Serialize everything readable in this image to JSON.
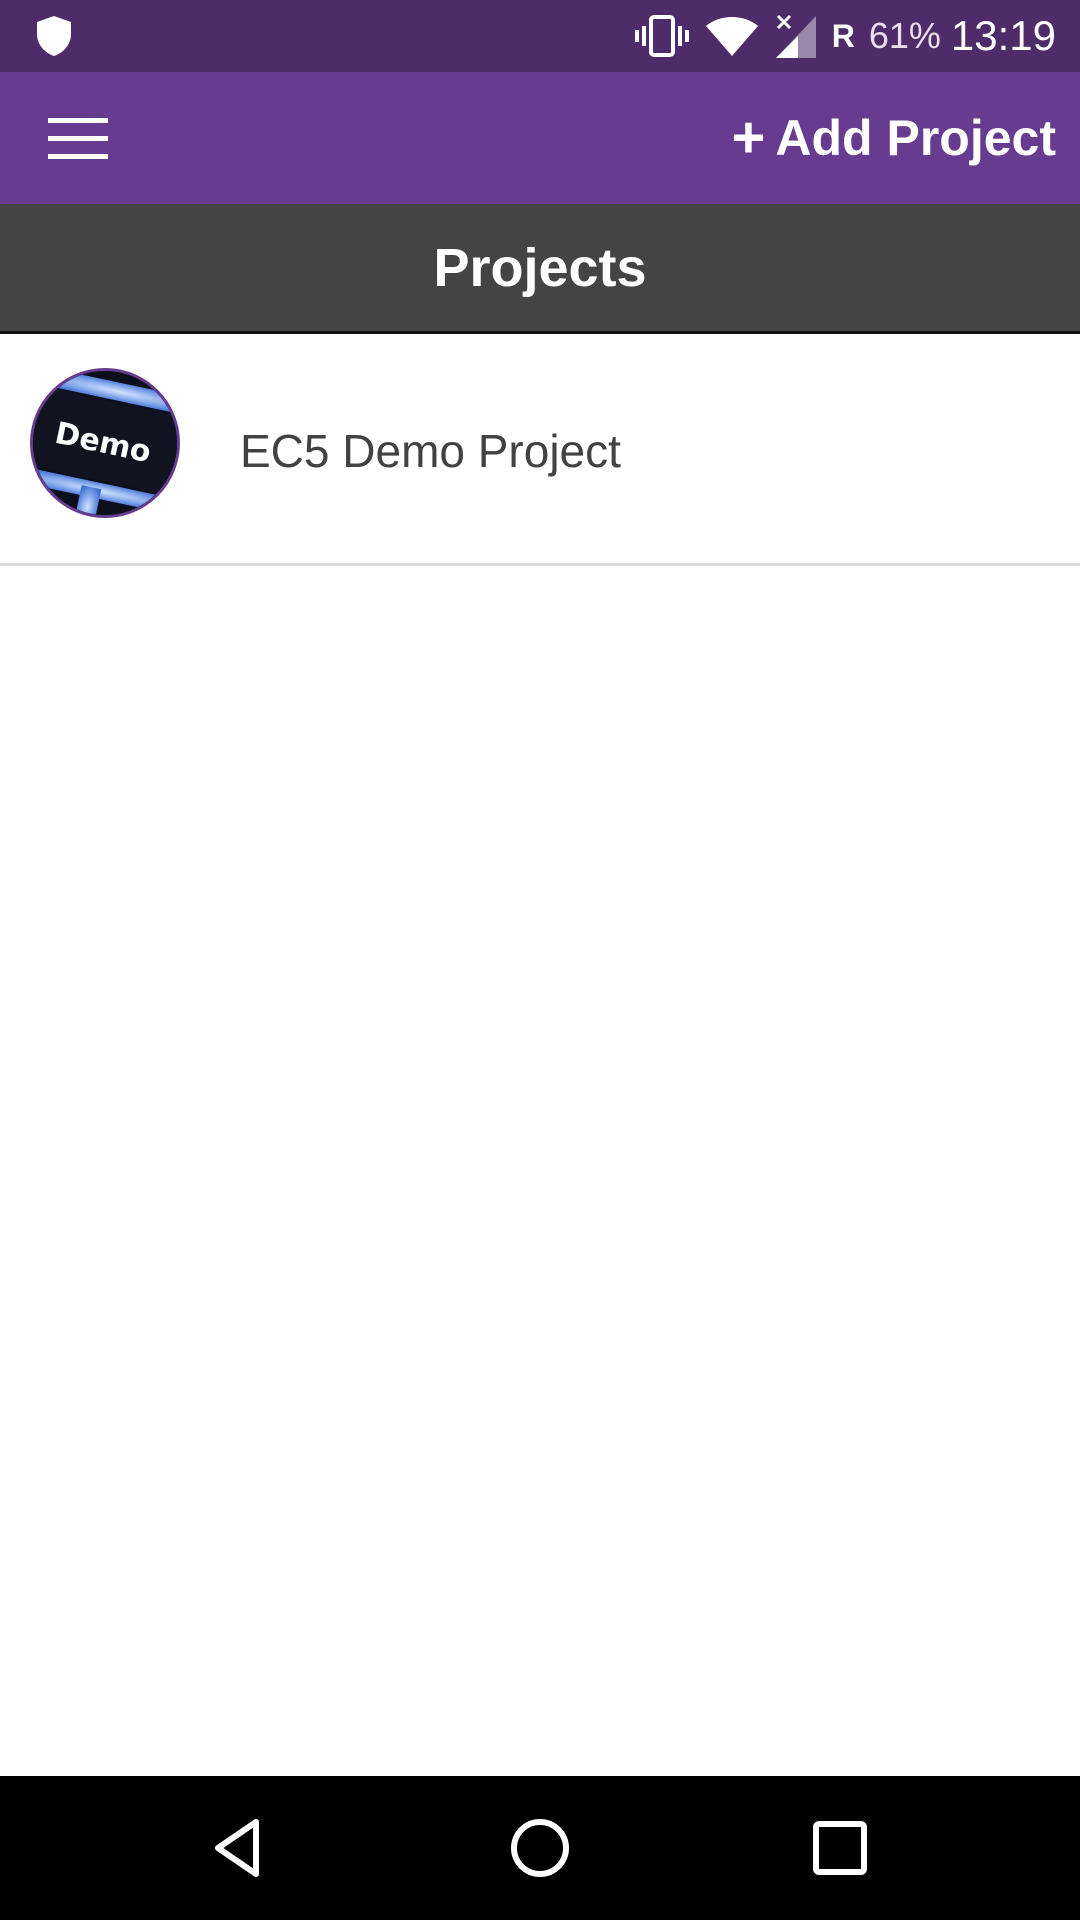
{
  "status_bar": {
    "icons": [
      "shield-icon",
      "vibrate-icon",
      "wifi-icon",
      "signal-icon"
    ],
    "roaming": "R",
    "battery": "61%",
    "time": "13:19"
  },
  "app_bar": {
    "menu_icon": "hamburger-menu-icon",
    "add_button_icon": "+",
    "add_button_label": "Add Project",
    "color": "#673b8f"
  },
  "header": {
    "title": "Projects"
  },
  "projects": [
    {
      "logo_text": "Demo",
      "name": "EC5 Demo Project"
    }
  ],
  "nav_bar": {
    "icons": [
      "back-icon",
      "home-icon",
      "recents-icon"
    ]
  },
  "colors": {
    "status_bar": "#4e2c6a",
    "app_bar": "#673b8f",
    "header": "#444444",
    "divider": "#dddddd"
  }
}
